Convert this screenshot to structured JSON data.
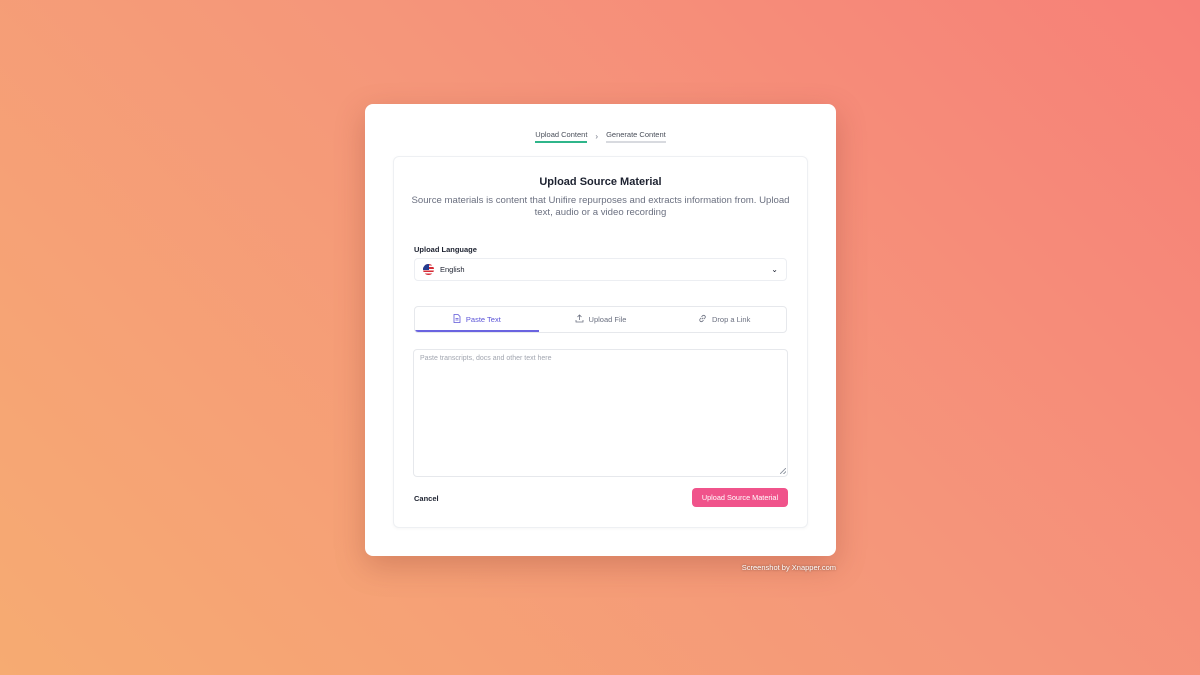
{
  "steps": {
    "upload": "Upload Content",
    "separator": "›",
    "generate": "Generate Content"
  },
  "form": {
    "title": "Upload Source Material",
    "subtitle": "Source materials is content that Unifire repurposes and extracts information from. Upload text, audio or a video recording",
    "language_label": "Upload Language",
    "language_value": "English",
    "tabs": [
      {
        "label": "Paste Text",
        "icon": "document-icon",
        "active": true
      },
      {
        "label": "Upload File",
        "icon": "upload-icon",
        "active": false
      },
      {
        "label": "Drop a Link",
        "icon": "link-icon",
        "active": false
      }
    ],
    "textarea_placeholder": "Paste transcripts, docs and other text here",
    "textarea_value": "",
    "cancel_label": "Cancel",
    "submit_label": "Upload Source Material"
  },
  "credit": "Screenshot by Xnapper.com",
  "colors": {
    "accent": "#5c55d8",
    "primary_button": "#f0538b",
    "step_active": "#2fb58a"
  }
}
